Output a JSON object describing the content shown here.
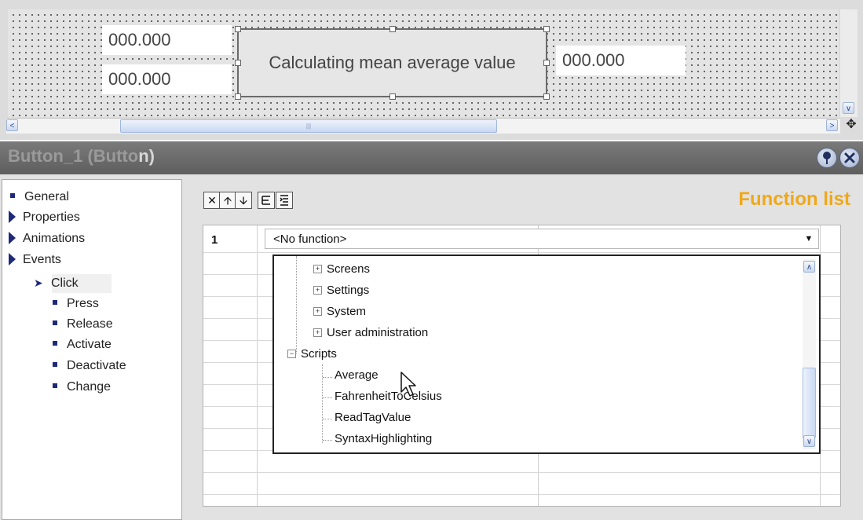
{
  "designer": {
    "io_left_top": "000.000",
    "io_left_bottom": "000.000",
    "button_text": "Calculating mean average value",
    "io_right": "000.000"
  },
  "panel": {
    "title_main": "Button_1 (Butto",
    "title_end": "n)"
  },
  "nav": {
    "items": [
      {
        "label": "General"
      },
      {
        "label": "Properties"
      },
      {
        "label": "Animations"
      },
      {
        "label": "Events"
      }
    ],
    "events": [
      {
        "label": "Click"
      },
      {
        "label": "Press"
      },
      {
        "label": "Release"
      },
      {
        "label": "Activate"
      },
      {
        "label": "Deactivate"
      },
      {
        "label": "Change"
      }
    ]
  },
  "function_list": {
    "title": "Function list",
    "row_number": "1",
    "selected_function": "<No function>",
    "tree": {
      "collapsed_groups": [
        "Screens",
        "Settings",
        "System",
        "User administration"
      ],
      "scripts_label": "Scripts",
      "scripts": [
        "Average",
        "FahrenheitToCelsius",
        "ReadTagValue",
        "SyntaxHighlighting"
      ]
    }
  },
  "icons": {
    "delete": "delete-icon",
    "up": "arrow-up-icon",
    "down": "arrow-down-icon",
    "pin": "pin-icon",
    "close": "close-icon"
  },
  "colors": {
    "accent_title": "#f0a818",
    "nav_marker": "#1e2a78"
  }
}
